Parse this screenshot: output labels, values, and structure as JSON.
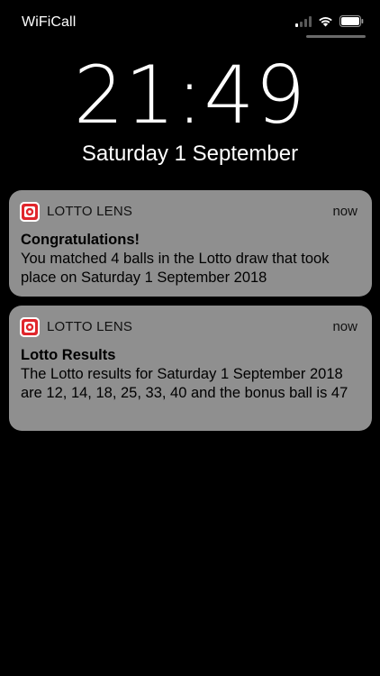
{
  "status_bar": {
    "carrier": "WiFiCall",
    "icons": [
      "signal-icon",
      "wifi-icon",
      "battery-icon"
    ]
  },
  "lock_screen": {
    "time": "21:49",
    "date": "Saturday 1 September"
  },
  "notifications": [
    {
      "app": "LOTTO LENS",
      "time": "now",
      "title": "Congratulations!",
      "body": "You matched 4 balls in the Lotto draw that took place on Saturday 1 September 2018"
    },
    {
      "app": "LOTTO LENS",
      "time": "now",
      "title": "Lotto Results",
      "body": "The Lotto results for Saturday 1 September 2018 are 12, 14, 18, 25, 33, 40 and the bonus ball is 47"
    }
  ],
  "colors": {
    "background": "#000000",
    "notification_bg": "#8f8f8f",
    "app_icon_red": "#e0262c"
  }
}
